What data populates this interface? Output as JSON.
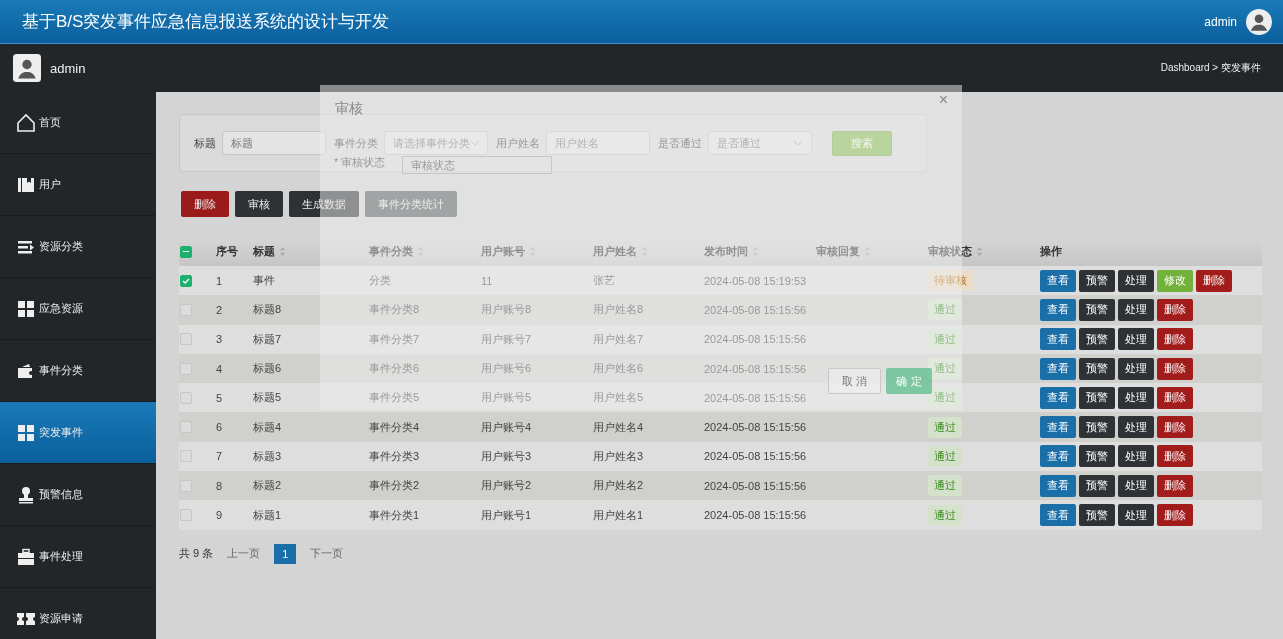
{
  "header": {
    "title": "基于B/S突发事件应急信息报送系统的设计与开发",
    "user": "admin"
  },
  "subbar": {
    "user": "admin",
    "breadcrumb": "Dashboard > 突发事件"
  },
  "sidebar": {
    "items": [
      {
        "label": "首页",
        "selected": false
      },
      {
        "label": "用户",
        "selected": false
      },
      {
        "label": "资源分类",
        "selected": false
      },
      {
        "label": "应急资源",
        "selected": false
      },
      {
        "label": "事件分类",
        "selected": false
      },
      {
        "label": "突发事件",
        "selected": true
      },
      {
        "label": "预警信息",
        "selected": false
      },
      {
        "label": "事件处理",
        "selected": false
      },
      {
        "label": "资源申请",
        "selected": false
      }
    ]
  },
  "search": {
    "fields": [
      {
        "label": "标题",
        "kind": "input",
        "placeholder": "标题"
      },
      {
        "label": "事件分类",
        "kind": "select",
        "placeholder": "请选择事件分类"
      },
      {
        "label": "用户姓名",
        "kind": "input",
        "placeholder": "用户姓名"
      },
      {
        "label": "是否通过",
        "kind": "select",
        "placeholder": "是否通过"
      }
    ],
    "button": "搜索"
  },
  "toolbar": [
    {
      "label": "删除",
      "kind": "danger"
    },
    {
      "label": "审核",
      "kind": "dark"
    },
    {
      "label": "生成数据",
      "kind": "dark"
    },
    {
      "label": "事件分类统计",
      "kind": "grey"
    }
  ],
  "table": {
    "select_all": {
      "indeterminate": true
    },
    "columns": [
      {
        "label": "序号",
        "sortable": false
      },
      {
        "label": "标题",
        "sortable": true
      },
      {
        "label": "事件分类",
        "sortable": true
      },
      {
        "label": "用户账号",
        "sortable": true
      },
      {
        "label": "用户姓名",
        "sortable": true
      },
      {
        "label": "发布时间",
        "sortable": true
      },
      {
        "label": "审核回复",
        "sortable": true
      },
      {
        "label": "审核状态",
        "sortable": true
      },
      {
        "label": "操作",
        "sortable": false
      }
    ],
    "rows": [
      {
        "checked": true,
        "no": "1",
        "title": "事件",
        "category": "分类",
        "account": "11",
        "name": "张艺",
        "time": "2024-05-08 15:19:53",
        "status": {
          "text": "待审核",
          "kind": "pending"
        },
        "actions": [
          {
            "label": "查看",
            "kind": "view"
          },
          {
            "label": "预警",
            "kind": "dark"
          },
          {
            "label": "处理",
            "kind": "dark"
          },
          {
            "label": "修改",
            "kind": "edit"
          },
          {
            "label": "删除",
            "kind": "delete"
          }
        ]
      },
      {
        "checked": false,
        "no": "2",
        "title": "标题8",
        "category": "事件分类8",
        "account": "用户账号8",
        "name": "用户姓名8",
        "time": "2024-05-08 15:15:56",
        "status": {
          "text": "通过",
          "kind": "passed"
        },
        "actions": [
          {
            "label": "查看",
            "kind": "view"
          },
          {
            "label": "预警",
            "kind": "dark"
          },
          {
            "label": "处理",
            "kind": "dark"
          },
          {
            "label": "删除",
            "kind": "delete"
          }
        ]
      },
      {
        "checked": false,
        "no": "3",
        "title": "标题7",
        "category": "事件分类7",
        "account": "用户账号7",
        "name": "用户姓名7",
        "time": "2024-05-08 15:15:56",
        "status": {
          "text": "通过",
          "kind": "passed"
        },
        "actions": [
          {
            "label": "查看",
            "kind": "view"
          },
          {
            "label": "预警",
            "kind": "dark"
          },
          {
            "label": "处理",
            "kind": "dark"
          },
          {
            "label": "删除",
            "kind": "delete"
          }
        ]
      },
      {
        "checked": false,
        "no": "4",
        "title": "标题6",
        "category": "事件分类6",
        "account": "用户账号6",
        "name": "用户姓名6",
        "time": "2024-05-08 15:15:56",
        "status": {
          "text": "通过",
          "kind": "passed"
        },
        "actions": [
          {
            "label": "查看",
            "kind": "view"
          },
          {
            "label": "预警",
            "kind": "dark"
          },
          {
            "label": "处理",
            "kind": "dark"
          },
          {
            "label": "删除",
            "kind": "delete"
          }
        ]
      },
      {
        "checked": false,
        "no": "5",
        "title": "标题5",
        "category": "事件分类5",
        "account": "用户账号5",
        "name": "用户姓名5",
        "time": "2024-05-08 15:15:56",
        "status": {
          "text": "通过",
          "kind": "passed"
        },
        "actions": [
          {
            "label": "查看",
            "kind": "view"
          },
          {
            "label": "预警",
            "kind": "dark"
          },
          {
            "label": "处理",
            "kind": "dark"
          },
          {
            "label": "删除",
            "kind": "delete"
          }
        ]
      },
      {
        "checked": false,
        "no": "6",
        "title": "标题4",
        "category": "事件分类4",
        "account": "用户账号4",
        "name": "用户姓名4",
        "time": "2024-05-08 15:15:56",
        "status": {
          "text": "通过",
          "kind": "passed"
        },
        "actions": [
          {
            "label": "查看",
            "kind": "view"
          },
          {
            "label": "预警",
            "kind": "dark"
          },
          {
            "label": "处理",
            "kind": "dark"
          },
          {
            "label": "删除",
            "kind": "delete"
          }
        ]
      },
      {
        "checked": false,
        "no": "7",
        "title": "标题3",
        "category": "事件分类3",
        "account": "用户账号3",
        "name": "用户姓名3",
        "time": "2024-05-08 15:15:56",
        "status": {
          "text": "通过",
          "kind": "passed"
        },
        "actions": [
          {
            "label": "查看",
            "kind": "view"
          },
          {
            "label": "预警",
            "kind": "dark"
          },
          {
            "label": "处理",
            "kind": "dark"
          },
          {
            "label": "删除",
            "kind": "delete"
          }
        ]
      },
      {
        "checked": false,
        "no": "8",
        "title": "标题2",
        "category": "事件分类2",
        "account": "用户账号2",
        "name": "用户姓名2",
        "time": "2024-05-08 15:15:56",
        "status": {
          "text": "通过",
          "kind": "passed"
        },
        "actions": [
          {
            "label": "查看",
            "kind": "view"
          },
          {
            "label": "预警",
            "kind": "dark"
          },
          {
            "label": "处理",
            "kind": "dark"
          },
          {
            "label": "删除",
            "kind": "delete"
          }
        ]
      },
      {
        "checked": false,
        "no": "9",
        "title": "标题1",
        "category": "事件分类1",
        "account": "用户账号1",
        "name": "用户姓名1",
        "time": "2024-05-08 15:15:56",
        "status": {
          "text": "通过",
          "kind": "passed"
        },
        "actions": [
          {
            "label": "查看",
            "kind": "view"
          },
          {
            "label": "预警",
            "kind": "dark"
          },
          {
            "label": "处理",
            "kind": "dark"
          },
          {
            "label": "删除",
            "kind": "delete"
          }
        ]
      }
    ]
  },
  "pagination": {
    "total": "共 9 条",
    "prev": "上一页",
    "pages": [
      {
        "label": "1",
        "selected": true
      }
    ],
    "next": "下一页"
  },
  "dialog": {
    "title": "审核",
    "close": "×",
    "status_label": "* 审核状态",
    "status_placeholder": "审核状态",
    "cancel": "取 消",
    "confirm": "确 定"
  }
}
